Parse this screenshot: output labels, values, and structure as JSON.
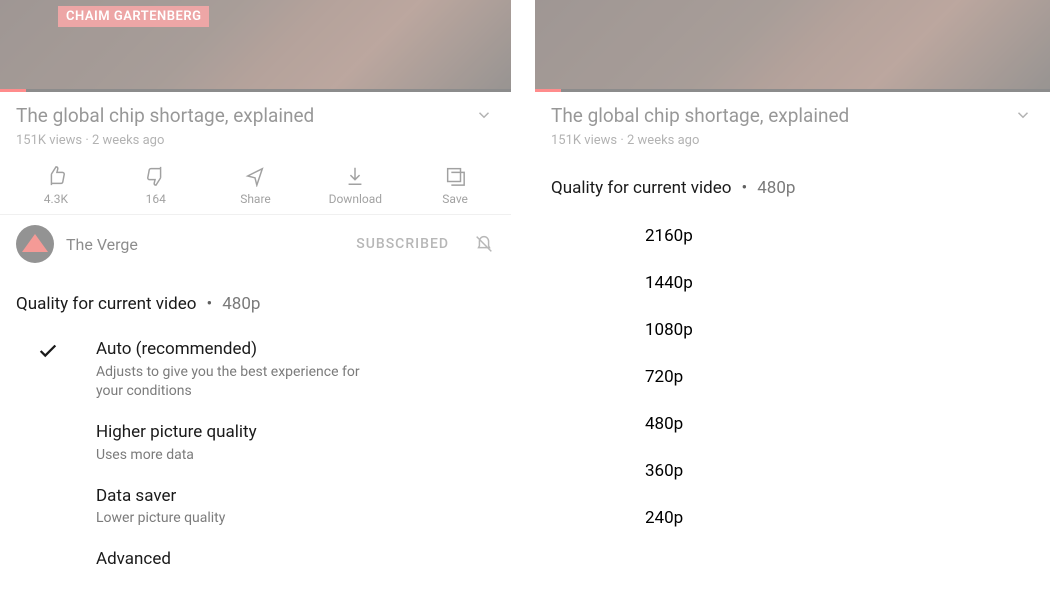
{
  "video": {
    "author_chip": "CHAIM GARTENBERG",
    "title": "The global chip shortage, explained",
    "views": "151K views",
    "age": "2 weeks ago"
  },
  "actions": {
    "like": {
      "label": "4.3K"
    },
    "dislike": {
      "label": "164"
    },
    "share": {
      "label": "Share"
    },
    "download": {
      "label": "Download"
    },
    "save": {
      "label": "Save"
    }
  },
  "channel": {
    "name": "The Verge",
    "subscribed_label": "SUBSCRIBED"
  },
  "sheet_left": {
    "title": "Quality for current video",
    "current": "480p",
    "options": [
      {
        "label": "Auto (recommended)",
        "desc": "Adjusts to give you the best experience for your conditions",
        "selected": true
      },
      {
        "label": "Higher picture quality",
        "desc": "Uses more data",
        "selected": false
      },
      {
        "label": "Data saver",
        "desc": "Lower picture quality",
        "selected": false
      },
      {
        "label": "Advanced",
        "desc": "",
        "selected": false
      }
    ]
  },
  "sheet_right": {
    "title": "Quality for current video",
    "current": "480p",
    "resolutions": [
      "2160p",
      "1440p",
      "1080p",
      "720p",
      "480p",
      "360p",
      "240p"
    ]
  }
}
